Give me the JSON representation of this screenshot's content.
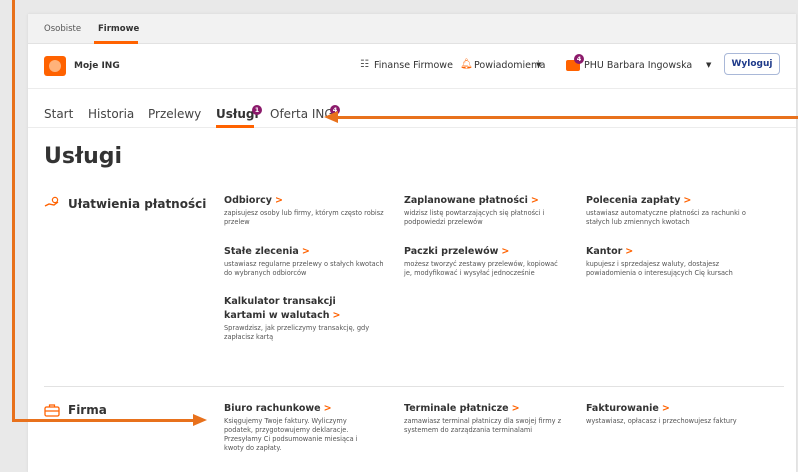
{
  "segments": [
    {
      "label": "Osobiste"
    },
    {
      "label": "Firmowe"
    }
  ],
  "header": {
    "brand": "Moje ING",
    "finance": "Finanse Firmowe",
    "notifications": "Powiadomienia",
    "user_badge": "4",
    "user": "PHU Barbara Ingowska",
    "logout": "Wyloguj"
  },
  "nav": {
    "start": "Start",
    "history": "Historia",
    "transfers": "Przelewy",
    "services": "Usługi",
    "services_badge": "1",
    "offer": "Oferta ING",
    "offer_badge": "4"
  },
  "page_title": "Usługi",
  "sections": [
    {
      "title": "Ułatwienia płatności",
      "items": [
        {
          "title": "Odbiorcy",
          "desc": "zapisujesz osoby lub firmy, którym często robisz przelew"
        },
        {
          "title": "Zaplanowane płatności",
          "desc": "widzisz listę powtarzających się płatności i podpowiedzi przelewów"
        },
        {
          "title": "Polecenia zapłaty",
          "desc": "ustawiasz automatyczne płatności za rachunki o stałych lub zmiennych kwotach"
        },
        {
          "title": "Stałe zlecenia",
          "desc": "ustawiasz regularne przelewy o stałych kwotach do wybranych odbiorców"
        },
        {
          "title": "Paczki przelewów",
          "desc": "możesz tworzyć zestawy przelewów, kopiować je, modyfikować i wysyłać jednocześnie"
        },
        {
          "title": "Kantor",
          "desc": "kupujesz i sprzedajesz waluty, dostajesz powiadomienia o interesujących Cię kursach"
        },
        {
          "title": "Kalkulator transakcji kartami w walutach",
          "desc": "Sprawdzisz, jak przeliczymy transakcję, gdy zapłacisz kartą"
        }
      ]
    },
    {
      "title": "Firma",
      "items": [
        {
          "title": "Biuro rachunkowe",
          "desc": "Księgujemy Twoje faktury. Wyliczymy podatek, przygotowujemy deklaracje. Przesyłamy Ci podsumowanie miesiąca i kwoty do zapłaty."
        },
        {
          "title": "Terminale płatnicze",
          "desc": "zamawiasz terminal płatniczy dla swojej firmy z systemem do zarządzania terminalami"
        },
        {
          "title": "Fakturowanie",
          "desc": "wystawiasz, opłacasz i przechowujesz faktury"
        }
      ]
    }
  ],
  "icons": {
    "payments": "hand-coins-icon",
    "company": "briefcase-icon",
    "finance": "list-icon",
    "notifications": "bell-icon",
    "user": "user-briefcase-icon",
    "chevron": "chevron-right-icon"
  },
  "colors": {
    "accent": "#ff6200",
    "badge": "#8b1a6b",
    "logout": "#1e3a8a",
    "overlay": "#e8711c"
  }
}
